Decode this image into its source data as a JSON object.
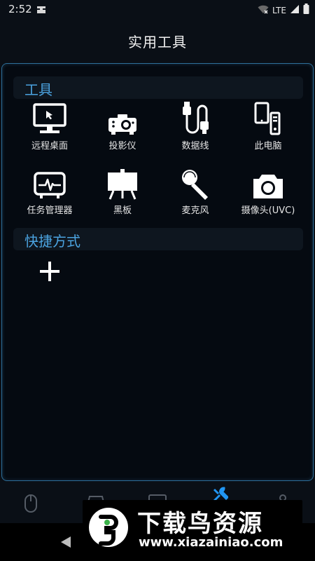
{
  "status": {
    "time": "2:52",
    "network": "LTE"
  },
  "app": {
    "title": "实用工具"
  },
  "tools_section": {
    "title": "工具",
    "items": [
      {
        "label": "远程桌面",
        "icon": "monitor-cursor-icon"
      },
      {
        "label": "投影仪",
        "icon": "projector-icon"
      },
      {
        "label": "数据线",
        "icon": "usb-cable-icon"
      },
      {
        "label": "此电脑",
        "icon": "pc-phone-icon"
      },
      {
        "label": "任务管理器",
        "icon": "heartbeat-monitor-icon"
      },
      {
        "label": "黑板",
        "icon": "blackboard-icon"
      },
      {
        "label": "麦克风",
        "icon": "microphone-icon"
      },
      {
        "label": "摄像头(UVC)",
        "icon": "camera-icon"
      }
    ]
  },
  "shortcuts_section": {
    "title": "快捷方式",
    "add_icon": "plus-icon"
  },
  "bottom_nav": {
    "items": [
      "mouse-icon",
      "gamepad-icon",
      "keyboard-icon",
      "tools-icon",
      "user-icon"
    ],
    "active_index": 3,
    "active_color": "#2196f3"
  },
  "watermark": {
    "title": "下载鸟资源",
    "url": "www.xiazainiao.com"
  },
  "colors": {
    "accent": "#4ba3e0",
    "border": "#2d6f9a",
    "background": "#0a0f16"
  }
}
